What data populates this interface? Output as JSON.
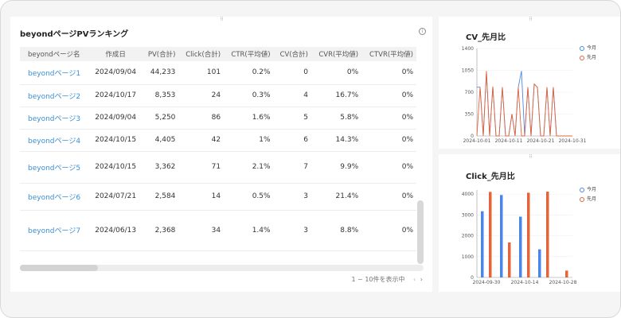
{
  "ranking": {
    "title": "beyondページPVランキング",
    "info_icon": "i",
    "columns": [
      "beyondページ名",
      "作成日",
      "PV(合計)",
      "Click(合計)",
      "CTR(平均値)",
      "CV(合計)",
      "CVR(平均値)",
      "CTVR(平均値)"
    ],
    "rows": [
      [
        "beyondページ1",
        "2024/09/04",
        "44,233",
        "101",
        "0.2%",
        "0",
        "0%",
        "0%"
      ],
      [
        "beyondページ2",
        "2024/10/17",
        "8,353",
        "24",
        "0.3%",
        "4",
        "16.7%",
        "0%"
      ],
      [
        "beyondページ3",
        "2024/09/04",
        "5,250",
        "86",
        "1.6%",
        "5",
        "5.8%",
        "0%"
      ],
      [
        "beyondページ4",
        "2024/10/15",
        "4,405",
        "42",
        "1%",
        "6",
        "14.3%",
        "0%"
      ],
      [
        "beyondページ5",
        "2024/10/15",
        "3,362",
        "71",
        "2.1%",
        "7",
        "9.9%",
        "0%"
      ],
      [
        "beyondページ6",
        "2024/07/21",
        "2,584",
        "14",
        "0.5%",
        "3",
        "21.4%",
        "0%"
      ],
      [
        "beyondページ7",
        "2024/06/13",
        "2,368",
        "34",
        "1.4%",
        "3",
        "8.8%",
        "0%"
      ]
    ],
    "pager_text": "1 ~ 10件を表示中",
    "prev_glyph": "‹",
    "next_glyph": "›"
  },
  "colors": {
    "this_month": "#4a86e8",
    "last_month": "#e5643a"
  },
  "chart_data": [
    {
      "type": "line",
      "title": "CV_先月比",
      "legend_position": "top-right",
      "series": [
        {
          "name": "今月",
          "values": [
            780,
            780,
            0,
            1020,
            0,
            790,
            0,
            0,
            780,
            0,
            0,
            350,
            0,
            780,
            1040,
            0,
            780,
            0,
            830,
            780,
            0,
            0,
            780,
            0,
            780,
            0,
            0,
            0,
            0,
            0,
            0
          ]
        },
        {
          "name": "先月",
          "values": [
            0,
            780,
            0,
            1040,
            0,
            790,
            0,
            0,
            780,
            0,
            0,
            350,
            0,
            780,
            0,
            0,
            780,
            0,
            830,
            780,
            0,
            0,
            780,
            0,
            780,
            0,
            0,
            0,
            0,
            0,
            0
          ]
        }
      ],
      "x_ticks": [
        "2024-10-01",
        "2024-10-11",
        "2024-10-21",
        "2024-10-31"
      ],
      "y_ticks": [
        "0",
        "350",
        "700",
        "1050",
        "1400"
      ],
      "ylim": [
        0,
        1400
      ]
    },
    {
      "type": "bar",
      "title": "Click_先月比",
      "legend_position": "top-right",
      "categories": [
        "2024-09-30",
        "2024-10-07",
        "2024-10-14",
        "2024-10-21",
        "2024-10-28"
      ],
      "series": [
        {
          "name": "今月",
          "values": [
            3180,
            3960,
            2920,
            1350,
            0
          ]
        },
        {
          "name": "先月",
          "values": [
            4110,
            1680,
            4070,
            4120,
            330
          ]
        }
      ],
      "x_ticks": [
        "2024-09-30",
        "2024-10-14",
        "2024-10-28"
      ],
      "y_ticks": [
        "0",
        "1000",
        "2000",
        "3000",
        "4000"
      ],
      "ylim": [
        0,
        4200
      ]
    }
  ]
}
